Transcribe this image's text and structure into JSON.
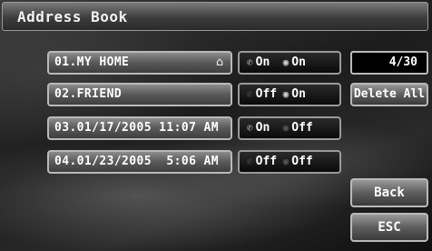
{
  "title": "Address Book",
  "counter": "4/30",
  "entries": [
    {
      "label": "01.MY HOME",
      "icon": "home-icon",
      "tel": "On",
      "alarm": "On"
    },
    {
      "label": "02.FRIEND",
      "tel": "Off",
      "alarm": "On"
    },
    {
      "label": "03.01/17/2005 11:07 AM",
      "tel": "On",
      "alarm": "Off"
    },
    {
      "label": "04.01/23/2005  5:06 AM",
      "tel": "Off",
      "alarm": "Off"
    }
  ],
  "buttons": {
    "delete_all": "Delete All",
    "back": "Back",
    "esc": "ESC"
  }
}
